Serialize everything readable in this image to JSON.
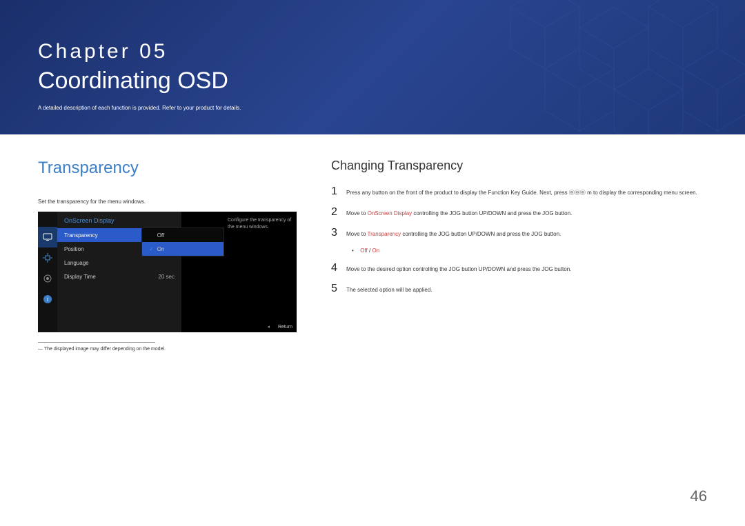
{
  "header": {
    "chapter_label": "Chapter  05",
    "title": "Coordinating OSD",
    "subtext": "A detailed description of each function is provided. Refer to your product for details."
  },
  "left": {
    "section_title": "Transparency",
    "description": "Set the transparency for the menu windows.",
    "footnote": "― The displayed image may differ depending on the model."
  },
  "osd": {
    "panel_title": "OnScreen Display",
    "items": [
      {
        "label": "Transparency",
        "value": "On",
        "selected": true
      },
      {
        "label": "Position",
        "value": "",
        "selected": false
      },
      {
        "label": "Language",
        "value": "",
        "selected": false
      },
      {
        "label": "Display Time",
        "value": "20 sec",
        "selected": false
      }
    ],
    "submenu": [
      {
        "label": "Off",
        "checked": false,
        "selected": false
      },
      {
        "label": "On",
        "checked": true,
        "selected": true
      }
    ],
    "caption": "Configure the transparency of the menu windows.",
    "return_label": "Return"
  },
  "right": {
    "heading": "Changing Transparency",
    "steps": [
      {
        "num": "1",
        "prefix": "Press any button on the front of the product to display the Function Key Guide. Next, press ",
        "hl": "",
        "mid": "",
        "hl2": "",
        "suffix": "m to display the corresponding menu screen."
      },
      {
        "num": "2",
        "prefix": "Move to ",
        "hl": "OnScreen Display",
        "mid": " controlling the JOG button UP/DOWN and press the JOG button.",
        "hl2": "",
        "suffix": ""
      },
      {
        "num": "3",
        "prefix": "Move to ",
        "hl": "Transparency",
        "mid": " controlling the JOG button UP/DOWN and press the JOG button.",
        "hl2": "",
        "suffix": ""
      }
    ],
    "bullet": {
      "opt1": "Off",
      "sep": " / ",
      "opt2": "On"
    },
    "steps2": [
      {
        "num": "4",
        "text": "Move to the desired option controlling the JOG button UP/DOWN and press the JOG button."
      },
      {
        "num": "5",
        "text": "The selected option will be applied."
      }
    ]
  },
  "page_number": "46"
}
